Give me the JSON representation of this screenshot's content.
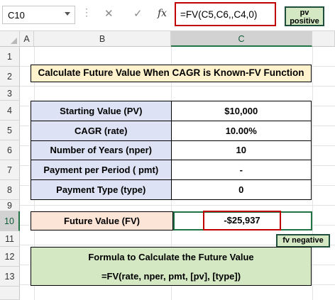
{
  "formula_bar": {
    "name_box": "C10",
    "cancel_icon": "✕",
    "enter_icon": "✓",
    "fx_icon": "fx",
    "formula": "=FV(C5,C6,,C4,0)"
  },
  "callouts": {
    "pv": "pv positive",
    "fv": "fv negative"
  },
  "columns": [
    "A",
    "B",
    "C"
  ],
  "rows": [
    "1",
    "2",
    "3",
    "4",
    "5",
    "6",
    "7",
    "8",
    "9",
    "10",
    "11",
    "12",
    "13"
  ],
  "selected_row": "10",
  "title": "Calculate Future Value When CAGR is Known-FV Function",
  "table": [
    {
      "label": "Starting Value (PV)",
      "value": "$10,000"
    },
    {
      "label": "CAGR (rate)",
      "value": "10.00%"
    },
    {
      "label": "Number of Years  (nper)",
      "value": "10"
    },
    {
      "label": "Payment per Period ( pmt)",
      "value": "-"
    },
    {
      "label": "Payment Type (type)",
      "value": "0"
    }
  ],
  "future_value": {
    "label": "Future Value (FV)",
    "value": "-$25,937"
  },
  "formula_box": {
    "line1": "Formula to Calculate the Future Value",
    "line2": "=FV(rate, nper, pmt, [pv], [type])"
  },
  "colors": {
    "title_bg": "#fff2cc",
    "label_bg": "#dde3f4",
    "fv_label_bg": "#fce4d6",
    "formula_bg": "#d3e8c3",
    "highlight_red": "#c00000",
    "selection_green": "#217346"
  }
}
